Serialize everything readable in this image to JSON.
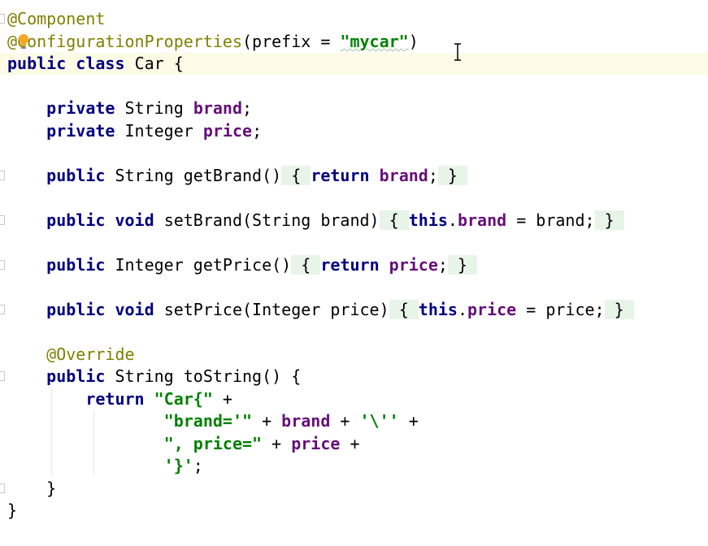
{
  "code": {
    "l1": {
      "ann": "@Component"
    },
    "l2": {
      "at": "@",
      "ann_rest": "ConfigurationProperties",
      "p1": "(prefix = ",
      "str": "\"mycar\"",
      "p2": ")"
    },
    "l3": {
      "kw1": "public",
      "kw2": "class",
      "name": "Car {"
    },
    "l4": {
      "kw": "private",
      "type": "String",
      "field": "brand",
      "end": ";"
    },
    "l5": {
      "kw": "private",
      "type": "Integer",
      "field": "price",
      "end": ";"
    },
    "l6": {
      "kw": "public",
      "rest": "String getBrand()",
      "ob": "{",
      "ret": "return",
      "field": "brand",
      "semi": ";",
      "cb": "}"
    },
    "l7": {
      "kw1": "public",
      "kw2": "void",
      "rest": "setBrand(String brand)",
      "ob": "{",
      "this": "this",
      "dot": ".",
      "field": "brand",
      "assign": " = brand;",
      "cb": "}"
    },
    "l8": {
      "kw": "public",
      "rest": "Integer getPrice()",
      "ob": "{",
      "ret": "return",
      "field": "price",
      "semi": ";",
      "cb": "}"
    },
    "l9": {
      "kw1": "public",
      "kw2": "void",
      "rest": "setPrice(Integer price)",
      "ob": "{",
      "this": "this",
      "dot": ".",
      "field": "price",
      "assign": " = price;",
      "cb": "}"
    },
    "l10": {
      "ann": "@Override"
    },
    "l11": {
      "kw": "public",
      "rest": "String toString() {"
    },
    "l12": {
      "ret": "return",
      "str": "\"Car{\"",
      "op": " +"
    },
    "l13": {
      "str": "\"brand='\"",
      "op1": " + ",
      "field": "brand",
      "op2": " + ",
      "str2": "'\\''",
      "op3": " +"
    },
    "l14": {
      "str": "\", price=\"",
      "op1": " + ",
      "field": "price",
      "op2": " +"
    },
    "l15": {
      "str": "'}'",
      "end": ";"
    },
    "l16": {
      "brace": "}"
    },
    "l17": {
      "brace": "}"
    }
  },
  "icons": {
    "bulb": "lightbulb-icon",
    "cursor": "text-cursor-icon"
  },
  "colors": {
    "keyword": "#000080",
    "annotation": "#808000",
    "string": "#008000",
    "field": "#660e7a",
    "fold_bg": "#e9f4e9",
    "current_line": "#fdfbe6",
    "bulb": "#f5a623"
  }
}
